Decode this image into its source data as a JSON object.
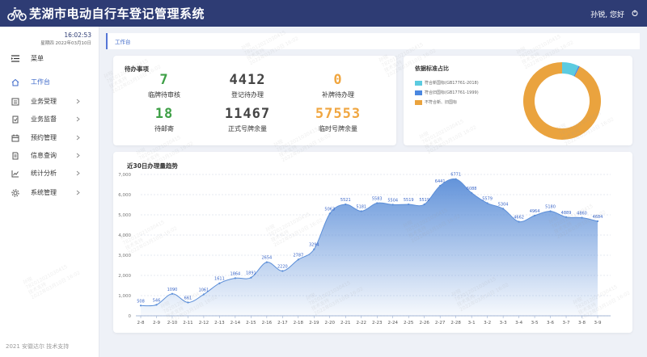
{
  "header": {
    "title": "芜湖市电动自行车登记管理系统",
    "greeting": "孙锐, 您好"
  },
  "sidebar": {
    "time": "16:02:53",
    "date": "星期四 2022年03月10日",
    "menu_label": "菜单",
    "items": [
      {
        "label": "工作台",
        "icon": "home-icon",
        "active": true,
        "chevron": false
      },
      {
        "label": "业务受理",
        "icon": "form-icon",
        "active": false,
        "chevron": true
      },
      {
        "label": "业务监督",
        "icon": "check-doc-icon",
        "active": false,
        "chevron": true
      },
      {
        "label": "预约管理",
        "icon": "calendar-icon",
        "active": false,
        "chevron": true
      },
      {
        "label": "信息查询",
        "icon": "doc-search-icon",
        "active": false,
        "chevron": true
      },
      {
        "label": "统计分析",
        "icon": "chart-icon",
        "active": false,
        "chevron": true
      },
      {
        "label": "系统管理",
        "icon": "gear-icon",
        "active": false,
        "chevron": true
      }
    ],
    "footer": "2021 安徽达尔 技术支持"
  },
  "tabs": [
    {
      "label": "工作台"
    }
  ],
  "todo": {
    "title": "待办事项",
    "stats": [
      {
        "value": "7",
        "caption": "临牌待审核",
        "color": "#3fa047"
      },
      {
        "value": "4412",
        "caption": "登记待办理",
        "color": "#444444"
      },
      {
        "value": "0",
        "caption": "补牌待办理",
        "color": "#f0a640"
      },
      {
        "value": "18",
        "caption": "待邮寄",
        "color": "#3fa047"
      },
      {
        "value": "11467",
        "caption": "正式号牌余量",
        "color": "#444444"
      },
      {
        "value": "57553",
        "caption": "临时号牌余量",
        "color": "#f0a640"
      }
    ]
  },
  "pie": {
    "title": "依据标准占比",
    "legend": [
      {
        "label": "符合新国标(GB17761-2018)",
        "color": "#5ccbe0",
        "value": 7
      },
      {
        "label": "符合旧国标(GB17761-1999)",
        "color": "#4a87e0",
        "value": 0.5
      },
      {
        "label": "不符合新、旧国标",
        "color": "#eaa33e",
        "value": 92.5
      }
    ]
  },
  "trend": {
    "title": "近30日办理量趋势"
  },
  "watermark": {
    "name": "孙锐",
    "id": "782012021030415",
    "org": "技术支持",
    "datetime": "2022年03月10日 16:02"
  },
  "chart_data": {
    "type": "area",
    "title": "近30日办理量趋势",
    "x": [
      "2-8",
      "2-9",
      "2-10",
      "2-11",
      "2-12",
      "2-13",
      "2-14",
      "2-15",
      "2-16",
      "2-17",
      "2-18",
      "2-19",
      "2-20",
      "2-21",
      "2-22",
      "2-23",
      "2-24",
      "2-25",
      "2-26",
      "2-27",
      "2-28",
      "3-1",
      "3-2",
      "3-3",
      "3-4",
      "3-5",
      "3-6",
      "3-7",
      "3-8",
      "3-9"
    ],
    "values": [
      508,
      546,
      1090,
      661,
      1061,
      1611,
      1864,
      1891,
      2654,
      2220,
      2787,
      3294,
      5063,
      5521,
      5181,
      5583,
      5504,
      5519,
      5519,
      6441,
      6771,
      6088,
      5579,
      5304,
      4662,
      4964,
      5180,
      4889,
      4860,
      4684
    ],
    "ylim": [
      0,
      7000
    ],
    "yticks": [
      0,
      1000,
      2000,
      3000,
      4000,
      5000,
      6000,
      7000
    ],
    "ytick_labels": [
      "0",
      "1,000",
      "2,000",
      "3,000",
      "4,000",
      "5,000",
      "6,000",
      "7,000"
    ],
    "line_color": "#5b8ed8",
    "grid": true
  }
}
